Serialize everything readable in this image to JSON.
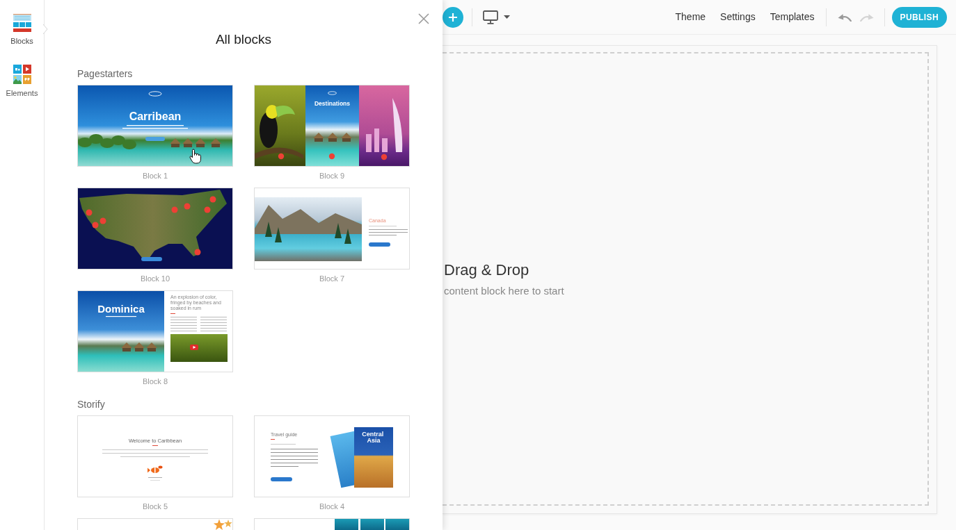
{
  "sidebar": {
    "items": [
      {
        "label": "Blocks",
        "selected": true
      },
      {
        "label": "Elements",
        "selected": false
      }
    ]
  },
  "panel": {
    "title": "All blocks",
    "sections": [
      {
        "heading": "Pagestarters",
        "blocks": [
          {
            "caption": "Block 1",
            "hovered": true,
            "preview": {
              "kind": "hero",
              "title": "Carribean"
            }
          },
          {
            "caption": "Block 9",
            "hovered": false,
            "preview": {
              "kind": "triptych",
              "title": "Destinations"
            }
          },
          {
            "caption": "Block 10",
            "hovered": false,
            "preview": {
              "kind": "map"
            }
          },
          {
            "caption": "Block 7",
            "hovered": false,
            "preview": {
              "kind": "photo-text",
              "title": "Canada"
            }
          },
          {
            "caption": "Block 8",
            "hovered": false,
            "preview": {
              "kind": "article",
              "title": "Dominica",
              "subtitle": "An explosion of color, fringed by beaches and soaked in rum"
            }
          }
        ]
      },
      {
        "heading": "Storify",
        "blocks": [
          {
            "caption": "Block 5",
            "hovered": false,
            "preview": {
              "kind": "welcome",
              "title": "Welcome to Caribbean"
            }
          },
          {
            "caption": "Block 4",
            "hovered": false,
            "preview": {
              "kind": "book",
              "title": "Travel guide",
              "cover_title": "Central Asia"
            }
          },
          {
            "hovered": false,
            "preview": {
              "kind": "starfish"
            }
          },
          {
            "hovered": false,
            "preview": {
              "kind": "gallery"
            }
          }
        ]
      }
    ]
  },
  "toolbar": {
    "links": [
      "Theme",
      "Settings",
      "Templates"
    ],
    "history": [
      {
        "kind": "undo",
        "disabled": false
      },
      {
        "kind": "redo",
        "disabled": true
      }
    ],
    "publish": "PUBLISH"
  },
  "canvas": {
    "title": "Drag & Drop",
    "hint": "content block here to start"
  }
}
